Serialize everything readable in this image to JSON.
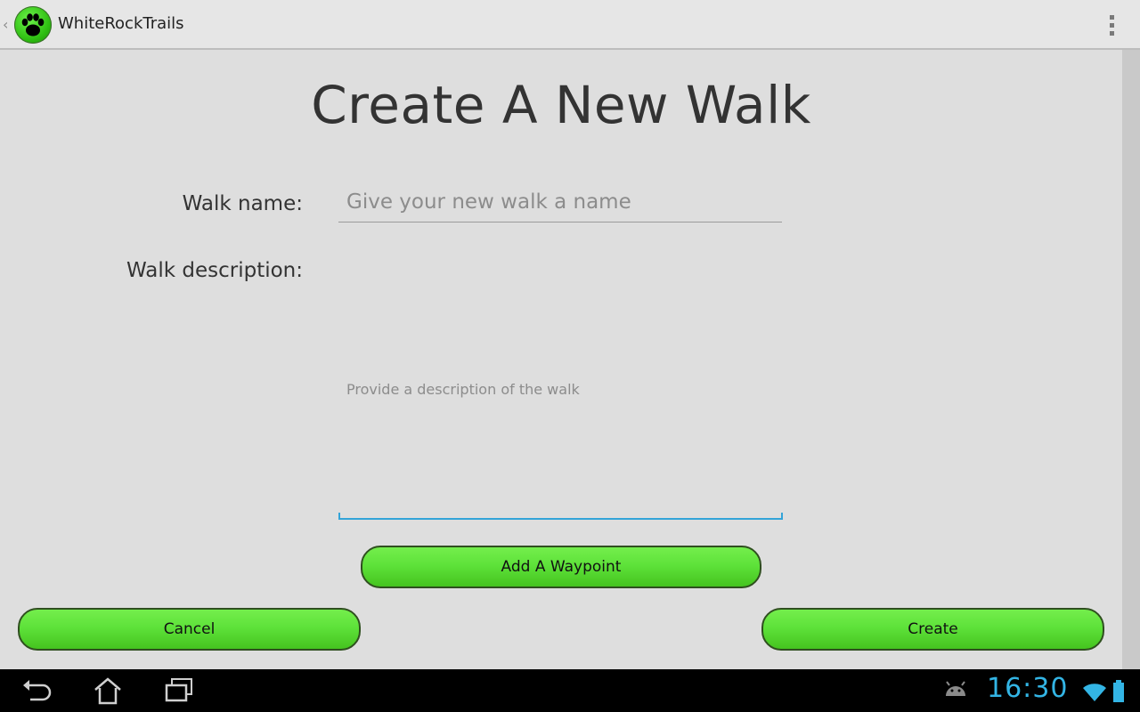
{
  "app": {
    "title": "WhiteRockTrails"
  },
  "page": {
    "heading": "Create A New Walk"
  },
  "form": {
    "walk_name_label": "Walk name:",
    "walk_name_placeholder": "Give your new walk a name",
    "walk_description_label": "Walk description:",
    "walk_description_placeholder": "Provide a description of the walk"
  },
  "buttons": {
    "add_waypoint": "Add A Waypoint",
    "cancel": "Cancel",
    "create": "Create"
  },
  "system_bar": {
    "time": "16:30",
    "icons": [
      "back-icon",
      "home-icon",
      "recent-apps-icon",
      "android-debug-icon",
      "wifi-icon",
      "battery-icon"
    ]
  },
  "colors": {
    "button_green": "#5ee23a",
    "accent_blue": "#33a4d8",
    "background": "#dedede"
  }
}
